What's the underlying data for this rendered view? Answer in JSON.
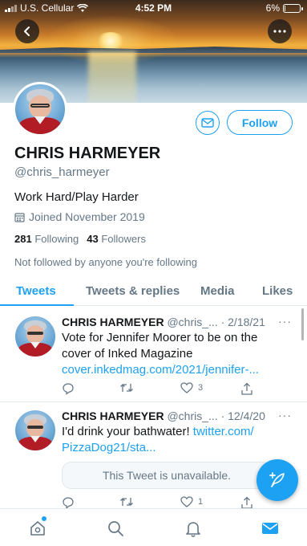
{
  "status_bar": {
    "carrier": "U.S. Cellular",
    "time": "4:52 PM",
    "battery": "6%",
    "battery_level": 0.06
  },
  "profile": {
    "name": "CHRIS HARMEYER",
    "handle": "@chris_harmeyer",
    "bio": "Work Hard/Play Harder",
    "joined": "Joined November 2019",
    "following_count": "281",
    "following_label": "Following",
    "followers_count": "43",
    "followers_label": "Followers",
    "followed_note": "Not followed by anyone you're following",
    "follow_label": "Follow"
  },
  "tabs": [
    {
      "label": "Tweets",
      "active": true
    },
    {
      "label": "Tweets & replies",
      "active": false
    },
    {
      "label": "Media",
      "active": false
    },
    {
      "label": "Likes",
      "active": false
    }
  ],
  "tweets": [
    {
      "name": "CHRIS HARMEYER",
      "handle": "@chris_...",
      "date": "· 2/18/21",
      "text": "Vote for Jennifer Moorer to be on the cover of Inked Magazine",
      "link": "cover.inkedmag.com/2021/jennifer-...",
      "like_count": "3"
    },
    {
      "name": "CHRIS HARMEYER",
      "handle": "@chris_...",
      "date": "· 12/4/20",
      "text": "I'd drink your bathwater!",
      "link_inline": "twitter.com/",
      "link": "PizzaDog21/sta...",
      "quote": "This Tweet is unavailable.",
      "like_count": "1"
    }
  ],
  "icons": {
    "back": "back-icon",
    "more": "more-icon",
    "mail": "mail-icon",
    "calendar": "calendar-icon",
    "reply": "reply-icon",
    "retweet": "retweet-icon",
    "like": "like-icon",
    "share": "share-icon",
    "compose": "compose-icon",
    "home": "home-icon",
    "search": "search-icon",
    "notifications": "bell-icon",
    "messages": "messages-icon"
  },
  "colors": {
    "accent": "#1da1f2",
    "text": "#14171a",
    "muted": "#657786",
    "border": "#e1e8ed"
  }
}
